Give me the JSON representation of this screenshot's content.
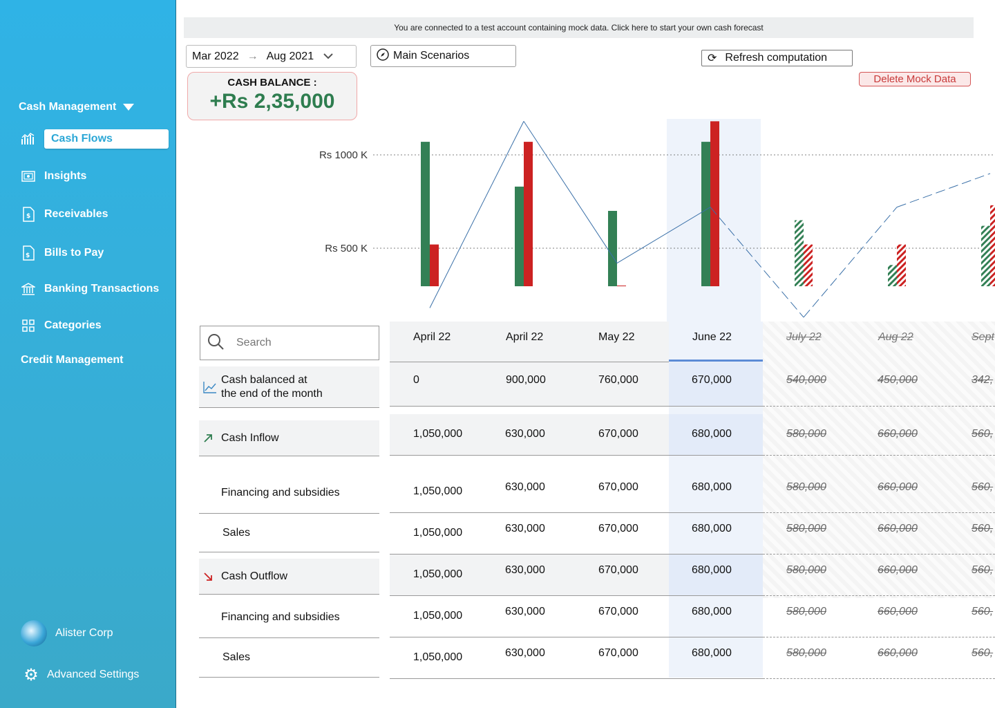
{
  "sidebar": {
    "section_cash": "Cash Management",
    "items": [
      {
        "label": "Cash Flows",
        "icon": "chart-icon"
      },
      {
        "label": "Insights",
        "icon": "insights-icon"
      },
      {
        "label": "Receivables",
        "icon": "receivables-doc-icon"
      },
      {
        "label": "Bills to Pay",
        "icon": "bill-icon"
      },
      {
        "label": "Banking Transactions",
        "icon": "bank-icon"
      },
      {
        "label": "Categories",
        "icon": "grid-icon"
      }
    ],
    "section_credit": "Credit Management",
    "company": "Alister Corp",
    "settings": "Advanced Settings"
  },
  "banner": "You are connected to a test account containing mock data. Click here to start your own cash forecast",
  "date_range": {
    "from": "Mar 2022",
    "to": "Aug 2021"
  },
  "scenario": "Main Scenarios",
  "refresh_label": "Refresh computation",
  "delete_label": "Delete Mock Data",
  "balance": {
    "title": "CASH BALANCE :",
    "value": "+Rs 2,35,000"
  },
  "colors": {
    "inflow": "#338055",
    "outflow": "#cc2222",
    "line": "#3a70a8",
    "accent": "#2fb3e6"
  },
  "chart_data": {
    "type": "bar",
    "categories": [
      "April 22",
      "April 22",
      "May 22",
      "June 22",
      "July 22",
      "Aug 22",
      "Sept"
    ],
    "series": [
      {
        "values": [
          1070,
          830,
          700,
          1070,
          650,
          410,
          620
        ]
      },
      {
        "values": [
          520,
          1070,
          300,
          1180,
          520,
          520,
          730
        ]
      },
      {
        "values": [
          180,
          1180,
          420,
          720,
          130,
          720,
          900
        ]
      }
    ],
    "y_ticks": [
      "Rs 1000 K",
      "Rs 500 K"
    ],
    "forecast_from_index": 4,
    "highlight_index": 3
  },
  "table": {
    "search_placeholder": "Search",
    "columns": [
      "April 22",
      "April 22",
      "May 22",
      "June 22",
      "July 22",
      "Aug 22",
      "Sept"
    ],
    "rows": [
      {
        "label": "Cash balanced at\nthe end of the month",
        "values": [
          "0",
          "900,000",
          "760,000",
          "670,000",
          "540,000",
          "450,000",
          "342,"
        ]
      },
      {
        "label": "Cash Inflow",
        "values": [
          "1,050,000",
          "630,000",
          "670,000",
          "680,000",
          "580,000",
          "660,000",
          "560,"
        ]
      },
      {
        "label": "Financing and subsidies",
        "values": [
          "1,050,000",
          "630,000",
          "670,000",
          "680,000",
          "580,000",
          "660,000",
          "560,"
        ]
      },
      {
        "label": "Sales",
        "values": [
          "1,050,000",
          "630,000",
          "670,000",
          "680,000",
          "580,000",
          "660,000",
          "560,"
        ]
      },
      {
        "label": "Cash Outflow",
        "values": [
          "1,050,000",
          "630,000",
          "670,000",
          "680,000",
          "580,000",
          "660,000",
          "560,"
        ]
      },
      {
        "label": "Financing and subsidies",
        "values": [
          "1,050,000",
          "630,000",
          "670,000",
          "680,000",
          "580,000",
          "660,000",
          "560,"
        ]
      },
      {
        "label": "Sales",
        "values": [
          "1,050,000",
          "630,000",
          "670,000",
          "680,000",
          "580,000",
          "660,000",
          "560,"
        ]
      }
    ]
  }
}
